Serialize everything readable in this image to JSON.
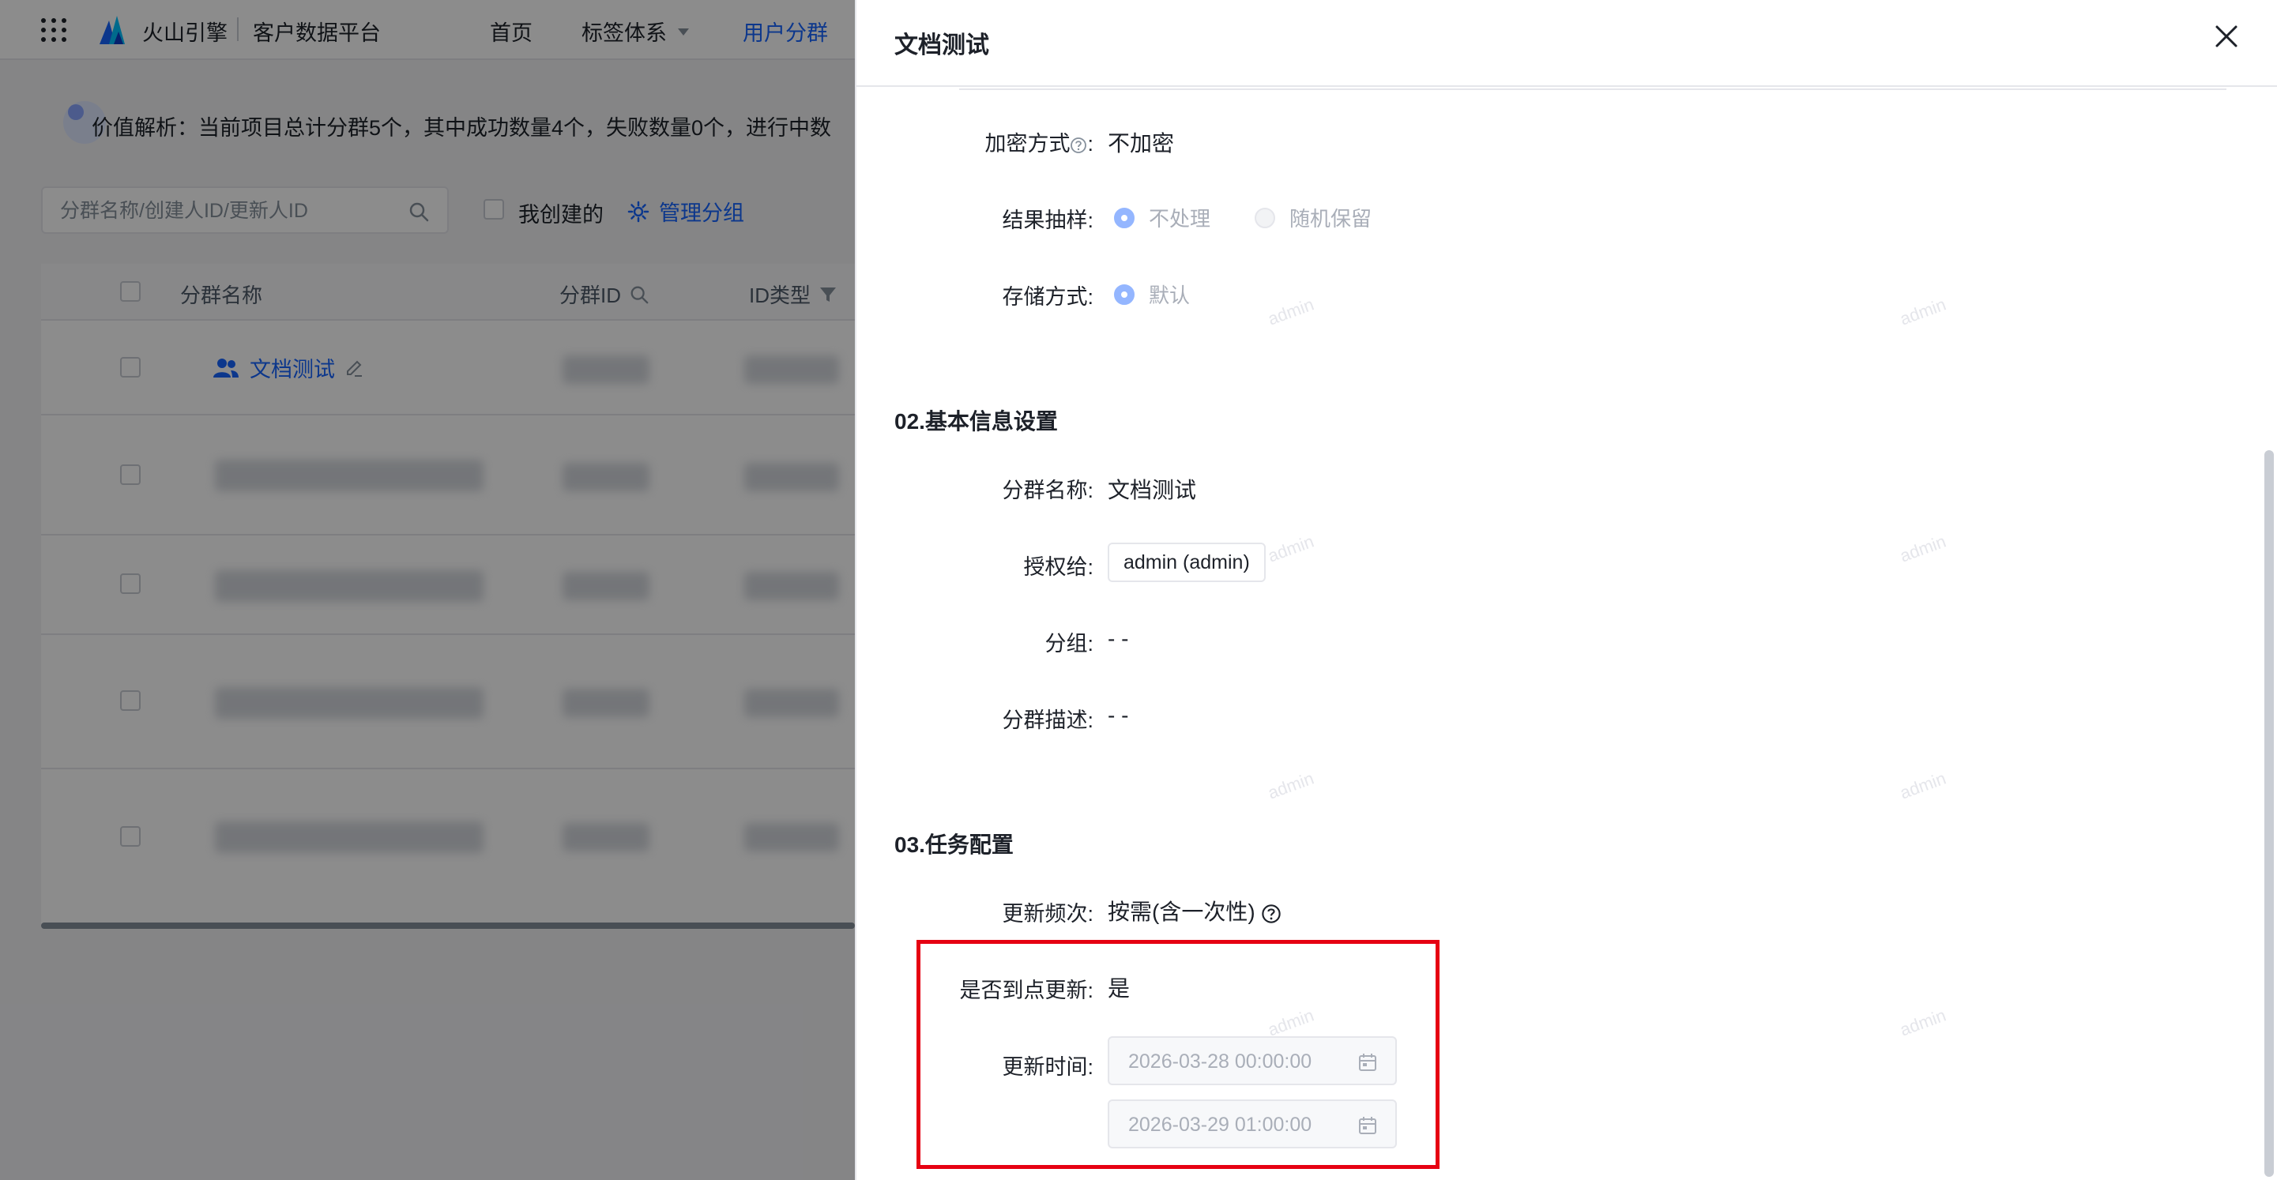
{
  "app": {
    "brand": "火山引擎",
    "platform": "客户数据平台",
    "nav": [
      "首页",
      "标签体系",
      "用户分群"
    ]
  },
  "banner": {
    "text": "价值解析：当前项目总计分群5个，其中成功数量4个，失败数量0个，进行中数"
  },
  "toolbar": {
    "search_placeholder": "分群名称/创建人ID/更新人ID",
    "mine_label": "我创建的",
    "manage_group_label": "管理分组"
  },
  "table": {
    "columns": [
      "分群名称",
      "分群ID",
      "ID类型"
    ],
    "rows": [
      {
        "name": "文档测试"
      }
    ]
  },
  "drawer": {
    "title": "文档测试",
    "encryption": {
      "label": "加密方式",
      "value": "不加密"
    },
    "sampling": {
      "label": "结果抽样:",
      "options": [
        "不处理",
        "随机保留"
      ],
      "selected": "不处理"
    },
    "storage": {
      "label": "存储方式:",
      "options": [
        "默认"
      ],
      "selected": "默认"
    },
    "section2": {
      "title": "02.基本信息设置",
      "name_label": "分群名称:",
      "name_value": "文档测试",
      "grant_label": "授权给:",
      "grant_value": "admin (admin)",
      "group_label": "分组:",
      "group_value": "- -",
      "desc_label": "分群描述:",
      "desc_value": "- -"
    },
    "section3": {
      "title": "03.任务配置",
      "freq_label": "更新频次:",
      "freq_value": "按需(含一次性)",
      "ontime_label": "是否到点更新:",
      "ontime_value": "是",
      "time_label": "更新时间:",
      "time_values": [
        "2026-03-28 00:00:00",
        "2026-03-29 01:00:00"
      ]
    },
    "watermark": "admin"
  },
  "colors": {
    "primary": "#1664ff",
    "highlight": "#e60012",
    "mask": "rgba(0,0,0,0.45)"
  }
}
